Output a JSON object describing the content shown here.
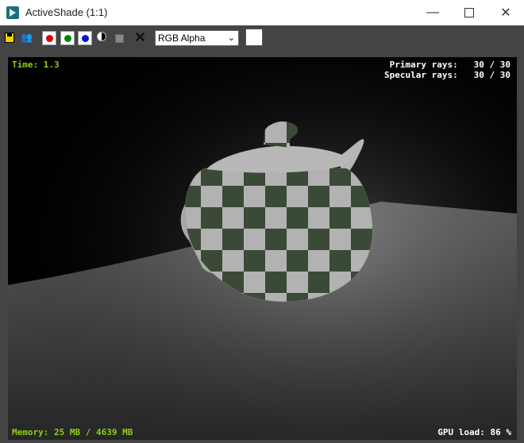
{
  "window": {
    "title": "ActiveShade (1:1)",
    "minimize": "—",
    "maximize": "",
    "close": "✕"
  },
  "toolbar": {
    "channel_value": "RGB Alpha",
    "channel_chevron": "⌄",
    "clear_label": "✕",
    "people_icon": "👥"
  },
  "render": {
    "time": "Time: 1.3",
    "primary_rays": "Primary rays:   30 / 30",
    "specular_rays": "Specular rays:   30 / 30",
    "memory": "Memory: 25 MB / 4639 MB",
    "gpu_load": "GPU load: 86 %"
  },
  "colors": {
    "red": "#e00000",
    "green": "#008a00",
    "blue": "#0018d8",
    "accent": "#8ccf13",
    "checker_a": "#3a4a37",
    "checker_b": "#b2b2b2"
  }
}
